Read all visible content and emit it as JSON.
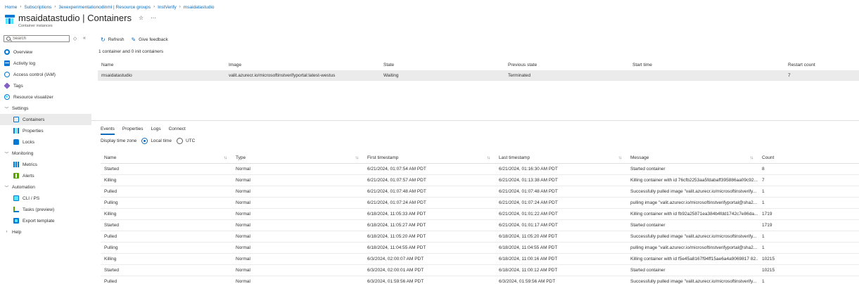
{
  "breadcrumb": [
    {
      "label": "Home"
    },
    {
      "label": "Subscriptions"
    },
    {
      "label": "3exexperimentationodinml | Resource groups"
    },
    {
      "label": "InstVerify"
    },
    {
      "label": "msaidatastudio"
    }
  ],
  "header": {
    "resource_name": "msaidatastudio",
    "separator": "|",
    "blade_title": "Containers",
    "subtitle": "Container instances",
    "favorite_glyph": "☆",
    "more_glyph": "···"
  },
  "sidebar": {
    "search_placeholder": "Search",
    "items": [
      {
        "label": "Overview",
        "icon": "overview-icon",
        "level": 0
      },
      {
        "label": "Activity log",
        "icon": "activity-log-icon",
        "level": 0
      },
      {
        "label": "Access control (IAM)",
        "icon": "iam-icon",
        "level": 0
      },
      {
        "label": "Tags",
        "icon": "tag-icon",
        "level": 0
      },
      {
        "label": "Resource visualizer",
        "icon": "resource-visualizer-icon",
        "level": 0
      },
      {
        "label": "Settings",
        "group": true,
        "expanded": true
      },
      {
        "label": "Containers",
        "icon": "containers-icon",
        "level": 1,
        "active": true
      },
      {
        "label": "Properties",
        "icon": "properties-icon",
        "level": 1
      },
      {
        "label": "Locks",
        "icon": "lock-icon",
        "level": 1
      },
      {
        "label": "Monitoring",
        "group": true,
        "expanded": true
      },
      {
        "label": "Metrics",
        "icon": "metrics-icon",
        "level": 1
      },
      {
        "label": "Alerts",
        "icon": "alerts-icon",
        "level": 1
      },
      {
        "label": "Automation",
        "group": true,
        "expanded": true
      },
      {
        "label": "CLI / PS",
        "icon": "cli-icon",
        "level": 1
      },
      {
        "label": "Tasks (preview)",
        "icon": "tasks-icon",
        "level": 1
      },
      {
        "label": "Export template",
        "icon": "export-template-icon",
        "level": 1
      },
      {
        "label": "Help",
        "group": true,
        "expanded": false
      }
    ]
  },
  "toolbar": {
    "refresh_label": "Refresh",
    "feedback_label": "Give feedback"
  },
  "summary_text": "1 container and 0 init containers",
  "containers": {
    "columns": [
      "Name",
      "Image",
      "State",
      "Previous state",
      "Start time",
      "Restart count"
    ],
    "rows": [
      [
        "msaidatastudio",
        "valit.azurecr.io/microsoftinstverifyportal:latest-westus",
        "Waiting",
        "Terminated",
        "",
        "7"
      ]
    ]
  },
  "tabs": [
    {
      "label": "Events",
      "active": true
    },
    {
      "label": "Properties"
    },
    {
      "label": "Logs"
    },
    {
      "label": "Connect"
    }
  ],
  "timezone": {
    "label": "Display time zone",
    "options": [
      {
        "label": "Local time",
        "selected": true
      },
      {
        "label": "UTC",
        "selected": false
      }
    ]
  },
  "events": {
    "columns": [
      "Name",
      "Type",
      "First timestamp",
      "Last timestamp",
      "Message",
      "Count"
    ],
    "sortable": [
      true,
      true,
      true,
      true,
      true,
      false
    ],
    "rows": [
      [
        "Started",
        "Normal",
        "6/21/2024, 01:07:54 AM PDT",
        "6/21/2024, 01:16:30 AM PDT",
        "Started container",
        "8"
      ],
      [
        "Killing",
        "Normal",
        "6/21/2024, 01:07:57 AM PDT",
        "6/21/2024, 01:13:38 AM PDT",
        "Killing container with id 76cfb2253aa5fdabaff395886aa09c92...",
        "7"
      ],
      [
        "Pulled",
        "Normal",
        "6/21/2024, 01:07:48 AM PDT",
        "6/21/2024, 01:07:48 AM PDT",
        "Successfully pulled image \"valit.azurecr.io/microsoftinstverify...",
        "1"
      ],
      [
        "Pulling",
        "Normal",
        "6/21/2024, 01:07:24 AM PDT",
        "6/21/2024, 01:07:24 AM PDT",
        "pulling image \"valit.azurecr.io/microsoftinstverifyportal@sha2...",
        "1"
      ],
      [
        "Killing",
        "Normal",
        "6/18/2024, 11:05:33 AM PDT",
        "6/21/2024, 01:01:22 AM PDT",
        "Killing container with id fb92a25871ea384b4fdd1742c7e86da...",
        "1719"
      ],
      [
        "Started",
        "Normal",
        "6/18/2024, 11:05:27 AM PDT",
        "6/21/2024, 01:01:17 AM PDT",
        "Started container",
        "1719"
      ],
      [
        "Pulled",
        "Normal",
        "6/18/2024, 11:05:20 AM PDT",
        "6/18/2024, 11:05:20 AM PDT",
        "Successfully pulled image \"valit.azurecr.io/microsoftinstverify...",
        "1"
      ],
      [
        "Pulling",
        "Normal",
        "6/18/2024, 11:04:55 AM PDT",
        "6/18/2024, 11:04:55 AM PDT",
        "pulling image \"valit.azurecr.io/microsoftinstverifyportal@sha2...",
        "1"
      ],
      [
        "Killing",
        "Normal",
        "6/3/2024, 02:00:07 AM PDT",
        "6/18/2024, 11:00:16 AM PDT",
        "Killing container with id f5e45a8167f94ff15ae6a4a9069817 82...",
        "10215"
      ],
      [
        "Started",
        "Normal",
        "6/3/2024, 02:00:01 AM PDT",
        "6/18/2024, 11:00:12 AM PDT",
        "Started container",
        "10215"
      ],
      [
        "Pulled",
        "Normal",
        "6/3/2024, 01:59:56 AM PDT",
        "6/3/2024, 01:59:56 AM PDT",
        "Successfully pulled image \"valit.azurecr.io/microsoftinstverify...",
        "1"
      ]
    ]
  },
  "colors": {
    "accent": "#0f6cbd",
    "selected_row": "#ebebeb",
    "divider": "#e1dfdd"
  }
}
